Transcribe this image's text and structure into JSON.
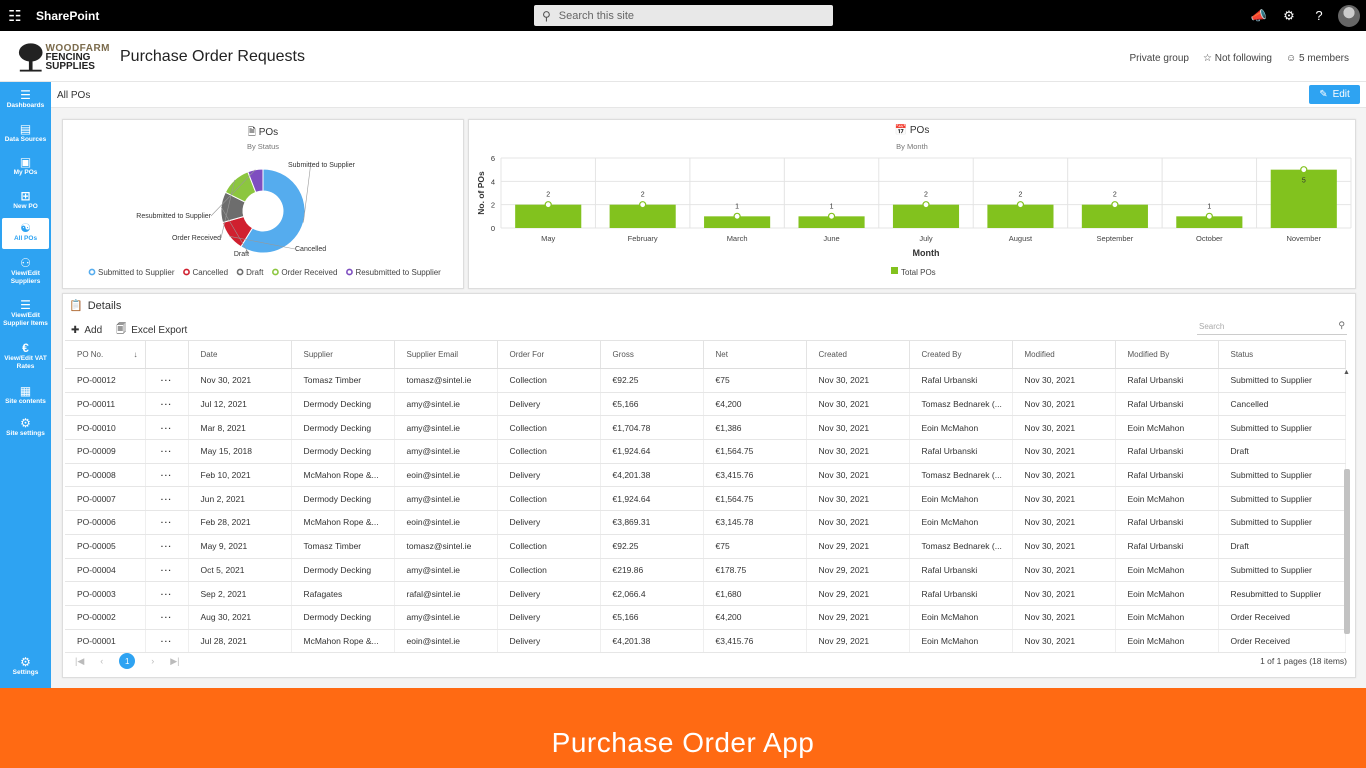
{
  "suite_bar": {
    "app_name": "SharePoint",
    "search_placeholder": "Search this site"
  },
  "site": {
    "logo_line1": "WOODFARM",
    "logo_line2": "FENCING",
    "logo_line3": "SUPPLIES",
    "title": "Purchase Order Requests",
    "privacy": "Private group",
    "follow": "Not following",
    "members": "5 members"
  },
  "left_nav": [
    {
      "label": "Dashboards",
      "icon": "menu-icon"
    },
    {
      "label": "Data Sources",
      "icon": "table-icon"
    },
    {
      "label": "My POs",
      "icon": "user-card-icon"
    },
    {
      "label": "New PO",
      "icon": "plus-box-icon"
    },
    {
      "label": "All POs",
      "icon": "stack-icon",
      "active": true
    },
    {
      "label": "View/Edit Suppliers",
      "icon": "people-icon"
    },
    {
      "label": "View/Edit Supplier Items",
      "icon": "list-icon"
    },
    {
      "label": "View/Edit VAT Rates",
      "icon": "euro-icon"
    },
    {
      "label": "Site contents",
      "icon": "grid-icon"
    },
    {
      "label": "Site settings",
      "icon": "gear-icon"
    },
    {
      "label": "Settings",
      "icon": "gears-icon"
    }
  ],
  "command_bar": {
    "page_label": "All POs",
    "edit_label": "Edit"
  },
  "status_chart": {
    "title": "POs",
    "subtitle": "By Status",
    "legend": [
      "Submitted to Supplier",
      "Cancelled",
      "Draft",
      "Order Received",
      "Resubmitted to Supplier"
    ],
    "colors": {
      "Submitted to Supplier": "#55acee",
      "Cancelled": "#d0202f",
      "Draft": "#6d6d6d",
      "Order Received": "#8cc63f",
      "Resubmitted to Supplier": "#7e4ec0"
    }
  },
  "month_chart": {
    "title": "POs",
    "subtitle": "By Month",
    "ylabel": "No. of POs",
    "xlabel": "Month",
    "legend": "Total POs",
    "bar_color": "#82c21e"
  },
  "chart_data": [
    {
      "type": "pie",
      "title": "POs",
      "subtitle": "By Status",
      "labels": [
        "Submitted to Supplier",
        "Cancelled",
        "Draft",
        "Order Received",
        "Resubmitted to Supplier"
      ],
      "values": [
        10,
        2,
        2,
        2,
        1
      ],
      "legend_placement": "bottom"
    },
    {
      "type": "bar",
      "title": "POs",
      "subtitle": "By Month",
      "categories": [
        "May",
        "February",
        "March",
        "June",
        "July",
        "August",
        "September",
        "October",
        "November"
      ],
      "values": [
        2,
        2,
        1,
        1,
        2,
        2,
        2,
        1,
        5
      ],
      "xlabel": "Month",
      "ylabel": "No. of POs",
      "ylim": [
        0,
        6
      ],
      "yticks": [
        "0",
        "2",
        "4",
        "6"
      ],
      "series_name": "Total POs",
      "grid": true,
      "legend_placement": "bottom"
    }
  ],
  "details": {
    "title": "Details",
    "add_label": "Add",
    "export_label": "Excel Export",
    "search_placeholder": "Search",
    "columns": [
      "PO No.",
      "",
      "Date",
      "Supplier",
      "Supplier Email",
      "Order For",
      "Gross",
      "Net",
      "Created",
      "Created By",
      "Modified",
      "Modified By",
      "Status"
    ],
    "rows": [
      [
        "PO-00012",
        "···",
        "Nov 30, 2021",
        "Tomasz Timber",
        "tomasz@sintel.ie",
        "Collection",
        "€92.25",
        "€75",
        "Nov 30, 2021",
        "Rafal Urbanski",
        "Nov 30, 2021",
        "Rafal Urbanski",
        "Submitted to Supplier"
      ],
      [
        "PO-00011",
        "···",
        "Jul 12, 2021",
        "Dermody Decking",
        "amy@sintel.ie",
        "Delivery",
        "€5,166",
        "€4,200",
        "Nov 30, 2021",
        "Tomasz Bednarek (...",
        "Nov 30, 2021",
        "Rafal Urbanski",
        "Cancelled"
      ],
      [
        "PO-00010",
        "···",
        "Mar 8, 2021",
        "Dermody Decking",
        "amy@sintel.ie",
        "Collection",
        "€1,704.78",
        "€1,386",
        "Nov 30, 2021",
        "Eoin McMahon",
        "Nov 30, 2021",
        "Eoin McMahon",
        "Submitted to Supplier"
      ],
      [
        "PO-00009",
        "···",
        "May 15, 2018",
        "Dermody Decking",
        "amy@sintel.ie",
        "Collection",
        "€1,924.64",
        "€1,564.75",
        "Nov 30, 2021",
        "Rafal Urbanski",
        "Nov 30, 2021",
        "Rafal Urbanski",
        "Draft"
      ],
      [
        "PO-00008",
        "···",
        "Feb 10, 2021",
        "McMahon Rope &...",
        "eoin@sintel.ie",
        "Delivery",
        "€4,201.38",
        "€3,415.76",
        "Nov 30, 2021",
        "Tomasz Bednarek (...",
        "Nov 30, 2021",
        "Rafal Urbanski",
        "Submitted to Supplier"
      ],
      [
        "PO-00007",
        "···",
        "Jun 2, 2021",
        "Dermody Decking",
        "amy@sintel.ie",
        "Collection",
        "€1,924.64",
        "€1,564.75",
        "Nov 30, 2021",
        "Eoin McMahon",
        "Nov 30, 2021",
        "Eoin McMahon",
        "Submitted to Supplier"
      ],
      [
        "PO-00006",
        "···",
        "Feb 28, 2021",
        "McMahon Rope &...",
        "eoin@sintel.ie",
        "Delivery",
        "€3,869.31",
        "€3,145.78",
        "Nov 30, 2021",
        "Eoin McMahon",
        "Nov 30, 2021",
        "Rafal Urbanski",
        "Submitted to Supplier"
      ],
      [
        "PO-00005",
        "···",
        "May 9, 2021",
        "Tomasz Timber",
        "tomasz@sintel.ie",
        "Collection",
        "€92.25",
        "€75",
        "Nov 29, 2021",
        "Tomasz Bednarek (...",
        "Nov 30, 2021",
        "Rafal Urbanski",
        "Draft"
      ],
      [
        "PO-00004",
        "···",
        "Oct 5, 2021",
        "Dermody Decking",
        "amy@sintel.ie",
        "Collection",
        "€219.86",
        "€178.75",
        "Nov 29, 2021",
        "Rafal Urbanski",
        "Nov 30, 2021",
        "Eoin McMahon",
        "Submitted to Supplier"
      ],
      [
        "PO-00003",
        "···",
        "Sep 2, 2021",
        "Rafagates",
        "rafal@sintel.ie",
        "Delivery",
        "€2,066.4",
        "€1,680",
        "Nov 29, 2021",
        "Rafal Urbanski",
        "Nov 30, 2021",
        "Eoin McMahon",
        "Resubmitted to Supplier"
      ],
      [
        "PO-00002",
        "···",
        "Aug 30, 2021",
        "Dermody Decking",
        "amy@sintel.ie",
        "Delivery",
        "€5,166",
        "€4,200",
        "Nov 29, 2021",
        "Eoin McMahon",
        "Nov 30, 2021",
        "Eoin McMahon",
        "Order Received"
      ],
      [
        "PO-00001",
        "···",
        "Jul 28, 2021",
        "McMahon Rope &...",
        "eoin@sintel.ie",
        "Delivery",
        "€4,201.38",
        "€3,415.76",
        "Nov 29, 2021",
        "Eoin McMahon",
        "Nov 30, 2021",
        "Eoin McMahon",
        "Order Received"
      ]
    ],
    "current_page": "1",
    "page_info": "1 of 1 pages (18 items)"
  },
  "banner": {
    "text": "Purchase Order App",
    "color": "#ff6a13"
  }
}
